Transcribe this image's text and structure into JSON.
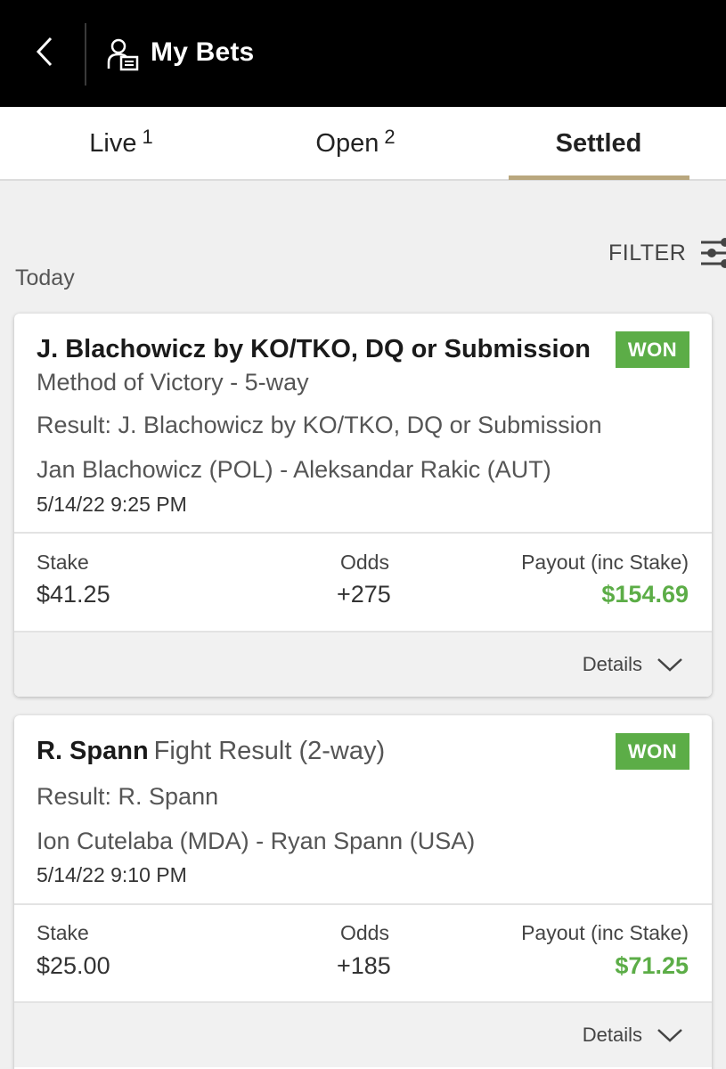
{
  "header": {
    "title": "My Bets",
    "back_icon": "chevron-left-icon",
    "user_icon": "user-ticket-icon"
  },
  "tabs": [
    {
      "label": "Live",
      "count": "1"
    },
    {
      "label": "Open",
      "count": "2"
    },
    {
      "label": "Settled",
      "count": ""
    }
  ],
  "active_tab": "Settled",
  "filter": {
    "label": "FILTER",
    "icon": "sliders-icon"
  },
  "section_label": "Today",
  "colors": {
    "accent": "#b9a77e",
    "won": "#5cad47",
    "header_bg": "#000000"
  },
  "bets": [
    {
      "selection": "J. Blachowicz by KO/TKO, DQ or Submission",
      "market": "Method of Victory - 5-way",
      "result": "Result: J. Blachowicz by KO/TKO, DQ or Submission",
      "event": "Jan Blachowicz (POL) - Aleksandar Rakic (AUT)",
      "datetime": "5/14/22 9:25 PM",
      "status": "WON",
      "stake_label": "Stake",
      "stake": "$41.25",
      "odds_label": "Odds",
      "odds": "+275",
      "payout_label": "Payout (inc Stake)",
      "payout": "$154.69",
      "details_label": "Details"
    },
    {
      "selection": "R. Spann",
      "market": "Fight Result (2-way)",
      "result": "Result: R. Spann",
      "event": "Ion Cutelaba (MDA) - Ryan Spann (USA)",
      "datetime": "5/14/22 9:10 PM",
      "status": "WON",
      "stake_label": "Stake",
      "stake": "$25.00",
      "odds_label": "Odds",
      "odds": "+185",
      "payout_label": "Payout (inc Stake)",
      "payout": "$71.25",
      "details_label": "Details"
    }
  ]
}
